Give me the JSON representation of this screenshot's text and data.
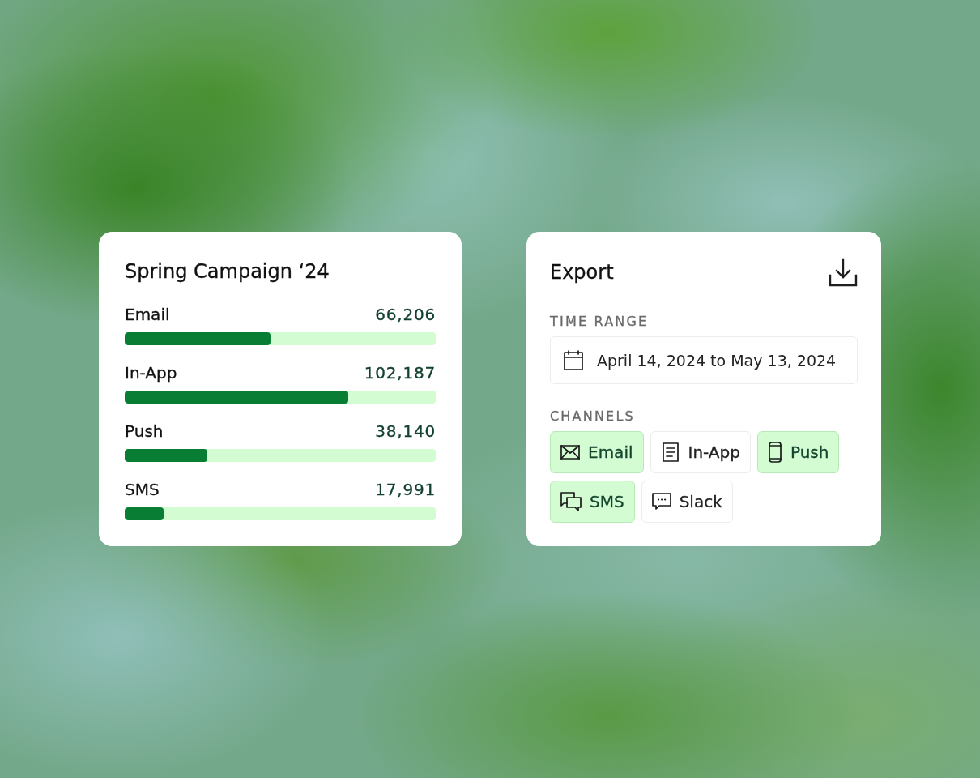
{
  "campaign_card": {
    "title": "Spring Campaign ‘24",
    "channels": [
      {
        "name": "Email",
        "count": "66,206",
        "level": 0.469
      },
      {
        "name": "In-App",
        "count": "102,187",
        "level": 0.719
      },
      {
        "name": "Push",
        "count": "38,140",
        "level": 0.266
      },
      {
        "name": "SMS",
        "count": "17,991",
        "level": 0.125
      }
    ]
  },
  "export_card": {
    "title": "Export",
    "time_range": {
      "label": "TIME RANGE",
      "value": "April 14, 2024 to May 13, 2024"
    },
    "channels": {
      "label": "CHANNELS",
      "options": [
        {
          "label": "Email",
          "kind": "email",
          "selected": true
        },
        {
          "label": "In-App",
          "kind": "in_app",
          "selected": false
        },
        {
          "label": "Push",
          "kind": "push",
          "selected": true
        },
        {
          "label": "SMS",
          "kind": "sms",
          "selected": true
        },
        {
          "label": "Slack",
          "kind": "slack",
          "selected": false
        }
      ]
    }
  }
}
